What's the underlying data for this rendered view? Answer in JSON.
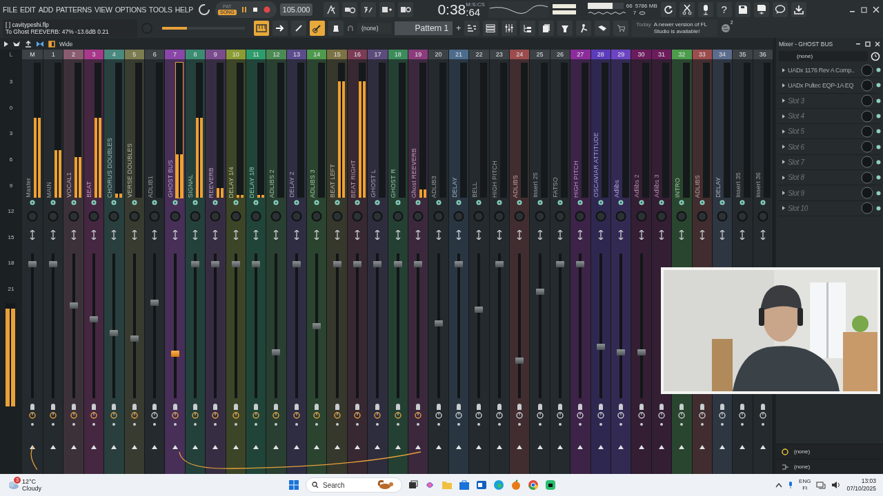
{
  "menu": [
    "FILE",
    "EDIT",
    "ADD",
    "PATTERNS",
    "VIEW",
    "OPTIONS",
    "TOOLS",
    "HELP"
  ],
  "transport": {
    "modes": [
      {
        "label": "PAT",
        "selected": false
      },
      {
        "label": "SONG",
        "selected": true
      }
    ],
    "tempo": "105.000"
  },
  "time": {
    "value": "0:38",
    "unit": "M:S:CS",
    "centiseconds": ":64"
  },
  "cpu": {
    "level": 0.7,
    "reading": "66",
    "memory": "5786 MB",
    "voices": "7"
  },
  "help": "?",
  "hint": {
    "file": "[ ]  cavitypeshi.flp",
    "text": "To Ghost REEVERB: 47%  -13.6dB  0.21"
  },
  "master_volume": {
    "level": 0.3
  },
  "pattern": {
    "snap": "(none)",
    "name": "Pattern 1",
    "add": "+"
  },
  "news": {
    "day": "Today",
    "message": "A newer version of FL Studio is available!",
    "count": "2"
  },
  "mixer_toolbar": {
    "stereo": "Wide"
  },
  "scale_header": "L",
  "scale": [
    "3",
    "0",
    "3",
    "6",
    "9",
    "12",
    "15",
    "18",
    "21"
  ],
  "output_meter": {
    "level": 0.95
  },
  "strips": [
    {
      "number": "M",
      "name": "Master",
      "color": "#3c4246",
      "meter": {
        "level": 0.59
      },
      "fader": {
        "level": 0.95
      },
      "selected": false
    },
    {
      "number": "1",
      "name": "MAIN",
      "color": "#3c4246",
      "meter": {
        "level": 0.35
      },
      "fader": {
        "level": 0.95
      },
      "selected": false
    },
    {
      "number": "2",
      "name": "VOCAL1",
      "color": "#8a5c70",
      "meter": {
        "level": 0.3
      },
      "fader": {
        "level": 0.65
      },
      "selected": false
    },
    {
      "number": "3",
      "name": "BEAT",
      "color": "#a8388a",
      "meter": {
        "level": 0.59
      },
      "fader": {
        "level": 0.55
      },
      "selected": false
    },
    {
      "number": "4",
      "name": "CHORUS DOUBLES",
      "color": "#4a8a7e",
      "meter": {
        "level": 0.03
      },
      "fader": {
        "level": 0.45
      },
      "selected": false
    },
    {
      "number": "5",
      "name": "VERSE DOUBLES",
      "color": "#7c7c50",
      "meter": {
        "level": 0
      },
      "fader": {
        "level": 0.41
      },
      "selected": false
    },
    {
      "number": "6",
      "name": "ADLIB1",
      "color": "#3c4246",
      "meter": {
        "level": 0
      },
      "fader": {
        "level": 0.67
      },
      "selected": false
    },
    {
      "number": "7",
      "name": "GHOST BUS",
      "color": "#8a46a8",
      "meter": {
        "level": 0.32
      },
      "fader": {
        "level": 0.3
      },
      "selected": true
    },
    {
      "number": "8",
      "name": "SIGNAL",
      "color": "#3c8c72",
      "meter": {
        "level": 0.59
      },
      "fader": {
        "level": 0.95
      },
      "selected": false
    },
    {
      "number": "9",
      "name": "REEVERB",
      "color": "#7a4c8e",
      "meter": {
        "level": 0.07
      },
      "fader": {
        "level": 0.95
      },
      "selected": false
    },
    {
      "number": "10",
      "name": "DELAY  1/4",
      "color": "#8c9c34",
      "meter": {
        "level": 0.02
      },
      "fader": {
        "level": 0.95
      },
      "selected": false
    },
    {
      "number": "11",
      "name": "DELAY  1/8",
      "color": "#2e9c6c",
      "meter": {
        "level": 0.02
      },
      "fader": {
        "level": 0.95
      },
      "selected": false
    },
    {
      "number": "12",
      "name": "ADLIBS 2",
      "color": "#4c8a54",
      "meter": {
        "level": 0
      },
      "fader": {
        "level": 0.31
      },
      "selected": false
    },
    {
      "number": "13",
      "name": "DELAY 2",
      "color": "#5c4c8e",
      "meter": {
        "level": 0
      },
      "fader": {
        "level": 0.95
      },
      "selected": false
    },
    {
      "number": "14",
      "name": "ADLIBS 3",
      "color": "#4e9a4e",
      "meter": {
        "level": 0
      },
      "fader": {
        "level": 0.5
      },
      "selected": false
    },
    {
      "number": "15",
      "name": "BEAT LEFT",
      "color": "#7c7244",
      "meter": {
        "level": 0.86
      },
      "fader": {
        "level": 0.95
      },
      "selected": false
    },
    {
      "number": "16",
      "name": "BEAT RIGHT",
      "color": "#7c3c54",
      "meter": {
        "level": 0.86
      },
      "fader": {
        "level": 0.95
      },
      "selected": false
    },
    {
      "number": "17",
      "name": "GHOST L",
      "color": "#5c4c7c",
      "meter": {
        "level": 0
      },
      "fader": {
        "level": 0.95
      },
      "selected": false
    },
    {
      "number": "18",
      "name": "GHOST R",
      "color": "#3c8c5c",
      "meter": {
        "level": 0
      },
      "fader": {
        "level": 0.95
      },
      "selected": false
    },
    {
      "number": "19",
      "name": "Ghost REEVERB",
      "color": "#8c3c7c",
      "meter": {
        "level": 0.06
      },
      "fader": {
        "level": 0.95
      },
      "selected": false
    },
    {
      "number": "20",
      "name": "ADLIB3",
      "color": "#3c4246",
      "meter": {
        "level": 0
      },
      "fader": {
        "level": 0.52
      },
      "selected": false
    },
    {
      "number": "21",
      "name": "DELAY",
      "color": "#4c6c8c",
      "meter": {
        "level": 0
      },
      "fader": {
        "level": 0.95
      },
      "selected": false
    },
    {
      "number": "22",
      "name": "BELL",
      "color": "#3c4246",
      "meter": {
        "level": 0
      },
      "fader": {
        "level": 0.62
      },
      "selected": false
    },
    {
      "number": "23",
      "name": "HIGH PITCH",
      "color": "#3c4246",
      "meter": {
        "level": 0
      },
      "fader": {
        "level": 0.95
      },
      "selected": false
    },
    {
      "number": "24",
      "name": "ADLIBS",
      "color": "#9c4c4c",
      "meter": {
        "level": 0
      },
      "fader": {
        "level": 0.25
      },
      "selected": false
    },
    {
      "number": "25",
      "name": "Insert 25",
      "color": "#3c4246",
      "meter": {
        "level": 0
      },
      "fader": {
        "level": 0.75
      },
      "selected": false
    },
    {
      "number": "26",
      "name": "FATSO",
      "color": "#3c4246",
      "meter": {
        "level": 0
      },
      "fader": {
        "level": 0.95
      },
      "selected": false
    },
    {
      "number": "27",
      "name": "HIGH PITCH",
      "color": "#8c2c9c",
      "meter": {
        "level": 0
      },
      "fader": {
        "level": 0.95
      },
      "selected": false
    },
    {
      "number": "28",
      "name": "OSCAVIAR ATTITUDE",
      "color": "#5c3cbc",
      "meter": {
        "level": 0
      },
      "fader": {
        "level": 0.35
      },
      "selected": false
    },
    {
      "number": "29",
      "name": "Adlibs",
      "color": "#6c44c4",
      "meter": {
        "level": 0
      },
      "fader": {
        "level": 0.31
      },
      "selected": false
    },
    {
      "number": "30",
      "name": "Adlibs 2",
      "color": "#6c1c5c",
      "meter": {
        "level": 0
      },
      "fader": {
        "level": 0.31
      },
      "selected": false
    },
    {
      "number": "31",
      "name": "Adlibs 3",
      "color": "#6c1c5c",
      "meter": {
        "level": 0
      },
      "selected": false
    },
    {
      "number": "32",
      "name": "INTRO",
      "color": "#4c9c4c",
      "meter": {
        "level": 0
      },
      "selected": false
    },
    {
      "number": "33",
      "name": "ADLIBS",
      "color": "#9c4c4c",
      "meter": {
        "level": 0
      },
      "selected": false
    },
    {
      "number": "34",
      "name": "DELAY",
      "color": "#5c6c8c",
      "meter": {
        "level": 0
      },
      "selected": false
    },
    {
      "number": "35",
      "name": "Insert 35",
      "color": "#3c4246",
      "meter": {
        "level": 0
      },
      "selected": false
    },
    {
      "number": "36",
      "name": "Insert 36",
      "color": "#3c4246",
      "meter": {
        "level": 0
      },
      "selected": false
    }
  ],
  "panel": {
    "title": "Mixer - GHOST BUS",
    "preset": "(none)",
    "slots": [
      {
        "name": "UADx 1176 Rev A Comp..",
        "kind": "plugin"
      },
      {
        "name": "UADx Pultec EQP-1A EQ",
        "kind": "plugin"
      },
      {
        "name": "Slot 3",
        "kind": "empty"
      },
      {
        "name": "Slot 4",
        "kind": "empty"
      },
      {
        "name": "Slot 5",
        "kind": "empty"
      },
      {
        "name": "Slot 6",
        "kind": "empty"
      },
      {
        "name": "Slot 7",
        "kind": "empty"
      },
      {
        "name": "Slot 8",
        "kind": "empty"
      },
      {
        "name": "Slot 9",
        "kind": "empty"
      },
      {
        "name": "Slot 10",
        "kind": "empty"
      }
    ],
    "outputs": [
      "(none)",
      "(none)"
    ]
  },
  "taskbar": {
    "temperature": "12°C",
    "weather": "Cloudy",
    "badge": "3",
    "search": "Search",
    "language": "ENG",
    "region": "FI",
    "time": "13:03",
    "date": "07/10/2025"
  }
}
